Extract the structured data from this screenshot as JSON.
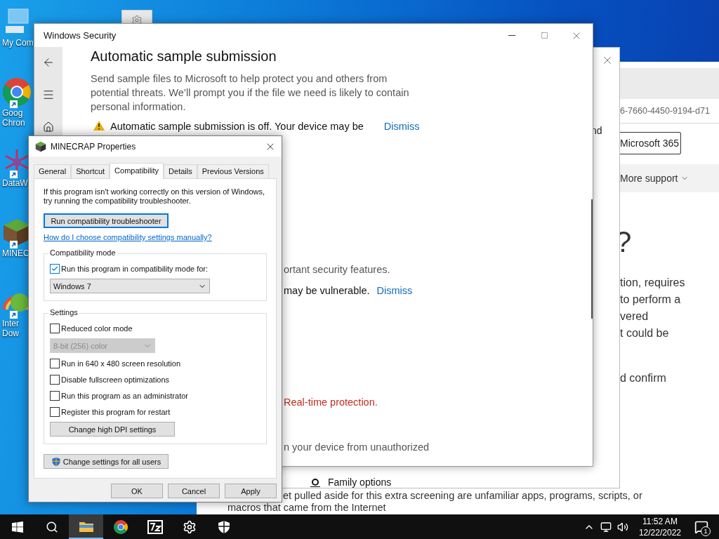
{
  "desktop": {
    "icons": [
      {
        "kind": "computer",
        "label_lines": [
          "My Com"
        ],
        "shortcut": false
      },
      {
        "kind": "chrome",
        "label_lines": [
          "Goog",
          "Chron"
        ],
        "shortcut": true
      },
      {
        "kind": "datawrapper",
        "label_lines": [
          "DataW"
        ],
        "shortcut": true
      },
      {
        "kind": "minecraft",
        "label_lines": [
          "MINEC"
        ],
        "shortcut": true
      },
      {
        "kind": "downloader",
        "label_lines": [
          "Inter",
          "Dow"
        ],
        "shortcut": true
      }
    ]
  },
  "browser_window": {
    "address_fragment": "6-7660-4450-9194-d71",
    "product_button": "Microsoft 365",
    "menu": "More support",
    "heading_fragment": "?",
    "paragraph_1_lines": [
      "tion, requires",
      "to perform a",
      "vered",
      "t could be"
    ],
    "paragraph_2_lines": [
      "d confirm"
    ],
    "body_lines": [
      "et pulled aside for this extra screening are unfamiliar apps, programs, scripts, or",
      "macros that came from the Internet"
    ]
  },
  "back_window": {
    "text_fragment": "nd",
    "nav_item": "Family options"
  },
  "security_window": {
    "title": "Windows Security",
    "heading": "Automatic sample submission",
    "description_lines": [
      "Send sample files to Microsoft to help protect you and others from",
      "potential threats. We’ll prompt you if the file we need is likely to contain",
      "personal information."
    ],
    "alert": {
      "text": "Automatic sample submission is off. Your device may be",
      "action": "Dismiss"
    },
    "fragments": [
      {
        "kind": "note",
        "text": "ortant security features."
      },
      {
        "kind": "alert",
        "text": "may be vulnerable.",
        "action": "Dismiss"
      },
      {
        "kind": "error",
        "text": "Real-time protection."
      },
      {
        "kind": "note",
        "text": "n your device from unauthorized"
      }
    ]
  },
  "properties_dialog": {
    "title": "MINECRAP Properties",
    "tabs": [
      {
        "label": "General",
        "selected": false
      },
      {
        "label": "Shortcut",
        "selected": false
      },
      {
        "label": "Compatibility",
        "selected": true
      },
      {
        "label": "Details",
        "selected": false
      },
      {
        "label": "Previous Versions",
        "selected": false
      }
    ],
    "intro_lines": [
      "If this program isn't working correctly on this version of Windows,",
      "try running the compatibility troubleshooter."
    ],
    "troubleshooter_button": "Run compatibility troubleshooter",
    "help_link": "How do I choose compatibility settings manually?",
    "compatibility_mode": {
      "legend": "Compatibility mode",
      "checkbox": {
        "label": "Run this program in compatibility mode for:",
        "checked": true
      },
      "os_select": {
        "value": "Windows 7",
        "disabled": false
      }
    },
    "settings": {
      "legend": "Settings",
      "options": [
        {
          "kind": "checkbox",
          "label": "Reduced color mode",
          "checked": false
        },
        {
          "kind": "select",
          "value": "8-bit (256) color",
          "disabled": true
        },
        {
          "kind": "checkbox",
          "label": "Run in 640 x 480 screen resolution",
          "checked": false
        },
        {
          "kind": "checkbox",
          "label": "Disable fullscreen optimizations",
          "checked": false
        },
        {
          "kind": "checkbox",
          "label": "Run this program as an administrator",
          "checked": false
        },
        {
          "kind": "checkbox",
          "label": "Register this program for restart",
          "checked": false
        }
      ],
      "dpi_button": "Change high DPI settings"
    },
    "all_users_button": "Change settings for all users",
    "buttons": [
      "OK",
      "Cancel",
      "Apply"
    ]
  },
  "taskbar": {
    "apps": [
      {
        "kind": "explorer",
        "selected": true
      },
      {
        "kind": "chrome",
        "selected": false
      },
      {
        "kind": "archiver",
        "selected": false
      },
      {
        "kind": "settings",
        "selected": false
      },
      {
        "kind": "security",
        "selected": false
      }
    ],
    "time": "11:52 AM",
    "date": "12/22/2022",
    "notification_count": "1"
  }
}
